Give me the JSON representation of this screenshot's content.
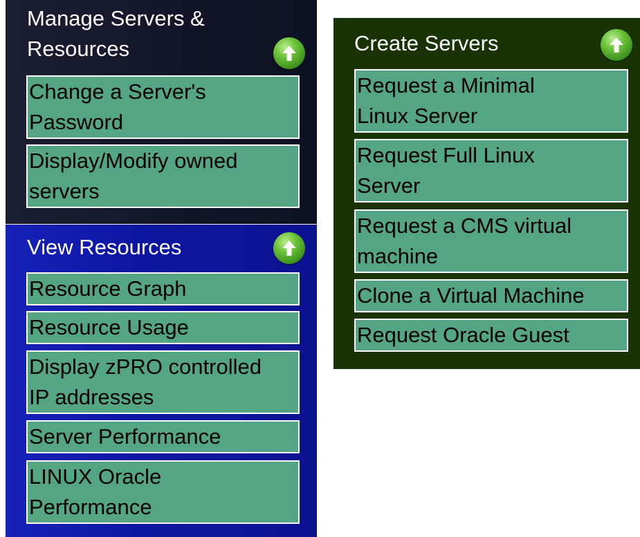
{
  "manage": {
    "title": "Manage Servers &\nResources",
    "items": [
      {
        "label": "Change a Server's\nPassword"
      },
      {
        "label": "Display/Modify owned\nservers"
      }
    ]
  },
  "view": {
    "title": "View Resources",
    "items": [
      {
        "label": "Resource Graph"
      },
      {
        "label": "Resource Usage"
      },
      {
        "label": "Display zPRO controlled\nIP addresses"
      },
      {
        "label": "Server Performance"
      },
      {
        "label": "LINUX Oracle\nPerformance"
      }
    ]
  },
  "create": {
    "title": "Create Servers",
    "items": [
      {
        "label": "Request a Minimal\nLinux Server"
      },
      {
        "label": "Request Full Linux\nServer"
      },
      {
        "label": "Request a CMS virtual\nmachine"
      },
      {
        "label": "Clone a Virtual Machine"
      },
      {
        "label": "Request Oracle Guest"
      }
    ]
  },
  "colors": {
    "manage_bg": "#121429",
    "view_bg": "#0c159e",
    "create_bg": "#1a3306",
    "item_bg": "#53a583",
    "item_border": "#ffffff",
    "up_button": "#5cb52e"
  },
  "icons": {
    "collapse": "up-arrow-icon"
  }
}
